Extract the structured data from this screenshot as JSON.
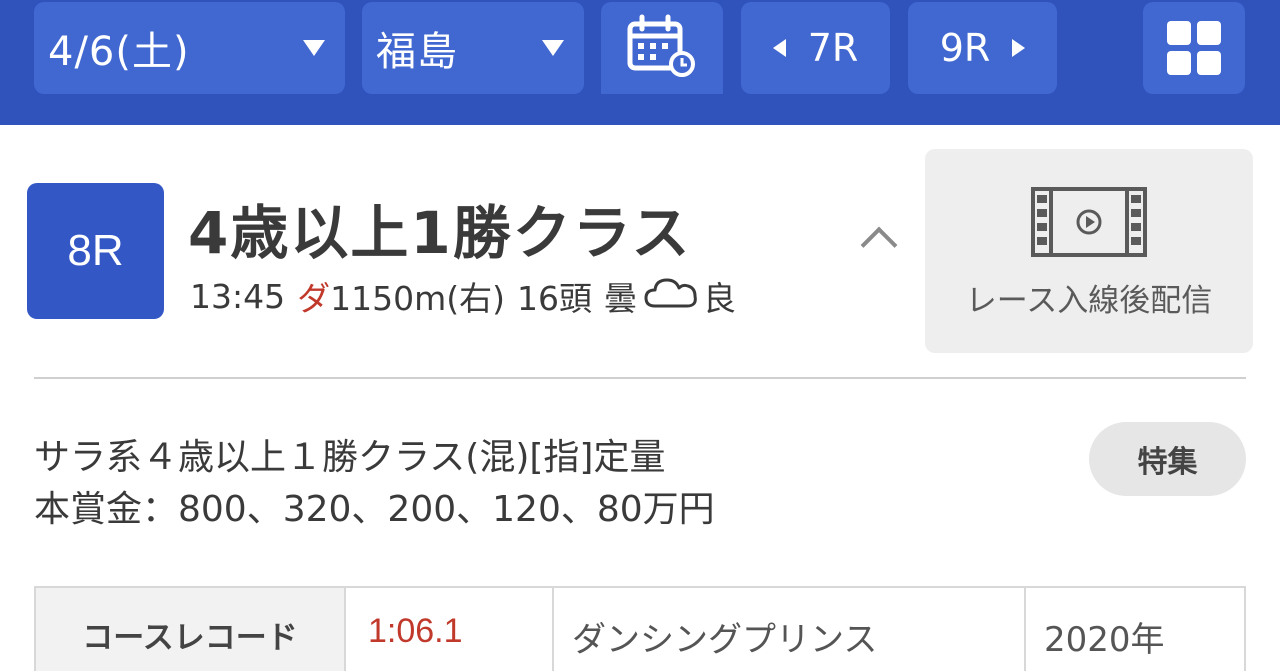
{
  "topbar": {
    "date_label": "4/6(土)",
    "venue_label": "福島",
    "calendar_icon": "calendar-refresh-icon",
    "prev_race_label": "7R",
    "next_race_label": "9R",
    "menu_icon": "grid-menu-icon",
    "background_color": "#2f52bb",
    "button_color": "#4168d1"
  },
  "race": {
    "number": "8R",
    "title": "4歳以上1勝クラス",
    "start_time": "13:45",
    "surface": "ダ",
    "distance": "1150m(右)",
    "runners": "16頭",
    "weather": "曇",
    "weather_icon": "cloud-icon",
    "track_condition": "良",
    "surface_color": "#c0392b",
    "badge_color": "#3457c6"
  },
  "video": {
    "icon": "film-play-icon",
    "label": "レース入線後配信"
  },
  "conditions": {
    "line1": "サラ系４歳以上１勝クラス(混)[指]定量",
    "line2": "本賞金：800、320、200、120、80万円",
    "feature_button": "特集"
  },
  "course_record": {
    "header": "コースレコード",
    "time": "1:06.1",
    "horse": "ダンシングプリンス",
    "year": "2020年",
    "time_color": "#c0392b"
  }
}
